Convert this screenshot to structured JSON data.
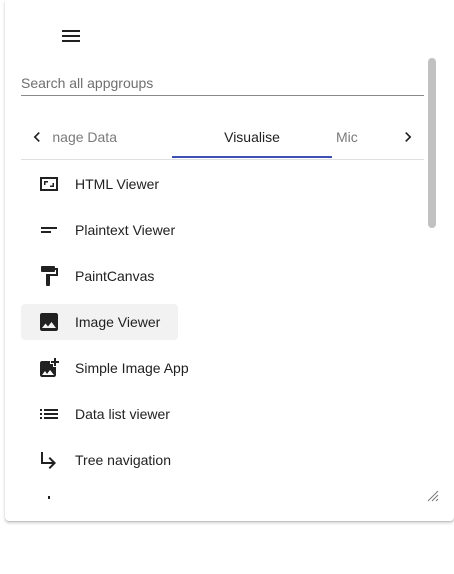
{
  "menu": {
    "icon": "hamburger-menu-icon"
  },
  "search": {
    "placeholder": "Search all appgroups",
    "value": ""
  },
  "tabs": {
    "items": [
      {
        "label": "Import & Manage Data",
        "visible_text": "& Manage Data"
      },
      {
        "label": "Visualise",
        "visible_text": "Visualise"
      },
      {
        "label": "Mic",
        "visible_text": "Mic"
      }
    ],
    "selected": "Visualise",
    "accent_color": "#3f51b5"
  },
  "apps": [
    {
      "label": "HTML Viewer",
      "icon": "frame-icon"
    },
    {
      "label": "Plaintext Viewer",
      "icon": "short-text-icon"
    },
    {
      "label": "PaintCanvas",
      "icon": "paint-roller-icon"
    },
    {
      "label": "Image Viewer",
      "icon": "image-icon",
      "selected": true
    },
    {
      "label": "Simple Image App",
      "icon": "add-photo-icon"
    },
    {
      "label": "Data list viewer",
      "icon": "list-icon"
    },
    {
      "label": "Tree navigation",
      "icon": "subdirectory-arrow-icon"
    }
  ]
}
